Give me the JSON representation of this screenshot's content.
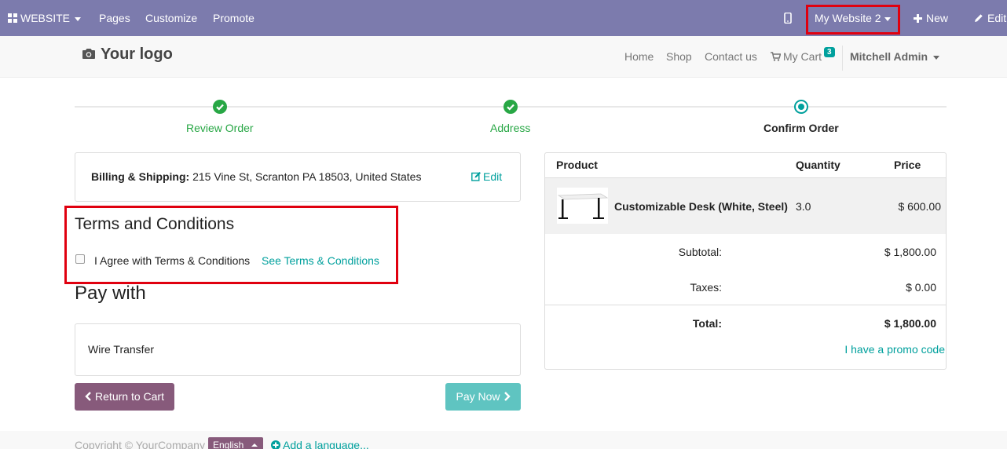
{
  "topbar": {
    "website_label": "WEBSITE",
    "pages": "Pages",
    "customize": "Customize",
    "promote": "Promote",
    "website_switch": "My Website 2",
    "new": "New",
    "edit": "Edit"
  },
  "header": {
    "logo": "Your logo",
    "nav": [
      "Home",
      "Shop",
      "Contact us"
    ],
    "cart_label": "My Cart",
    "cart_count": "3",
    "user": "Mitchell Admin"
  },
  "progress": {
    "steps": [
      "Review Order",
      "Address",
      "Confirm Order"
    ]
  },
  "billing": {
    "label": "Billing & Shipping:",
    "address": "215 Vine St, Scranton PA 18503, United States",
    "edit": "Edit"
  },
  "terms": {
    "title": "Terms and Conditions",
    "agree": "I Agree with Terms & Conditions",
    "see": "See Terms & Conditions"
  },
  "payment": {
    "title": "Pay with",
    "method": "Wire Transfer",
    "return": "Return to Cart",
    "pay": "Pay Now"
  },
  "order": {
    "headers": [
      "Product",
      "Quantity",
      "Price"
    ],
    "item_name": "Customizable Desk (White, Steel)",
    "item_qty": "3.0",
    "item_price": "$ 600.00",
    "subtotal_label": "Subtotal:",
    "subtotal": "$ 1,800.00",
    "taxes_label": "Taxes:",
    "taxes": "$ 0.00",
    "total_label": "Total:",
    "total": "$ 1,800.00",
    "promo": "I have a promo code"
  },
  "footer": {
    "copyright": "Copyright © YourCompany",
    "language": "English",
    "add_language": "Add a language..."
  },
  "colors": {
    "topbar": "#7c7bad",
    "accent": "#00a09d",
    "done": "#28a745",
    "return_btn": "#875a7b",
    "highlight": "#e0000f"
  }
}
